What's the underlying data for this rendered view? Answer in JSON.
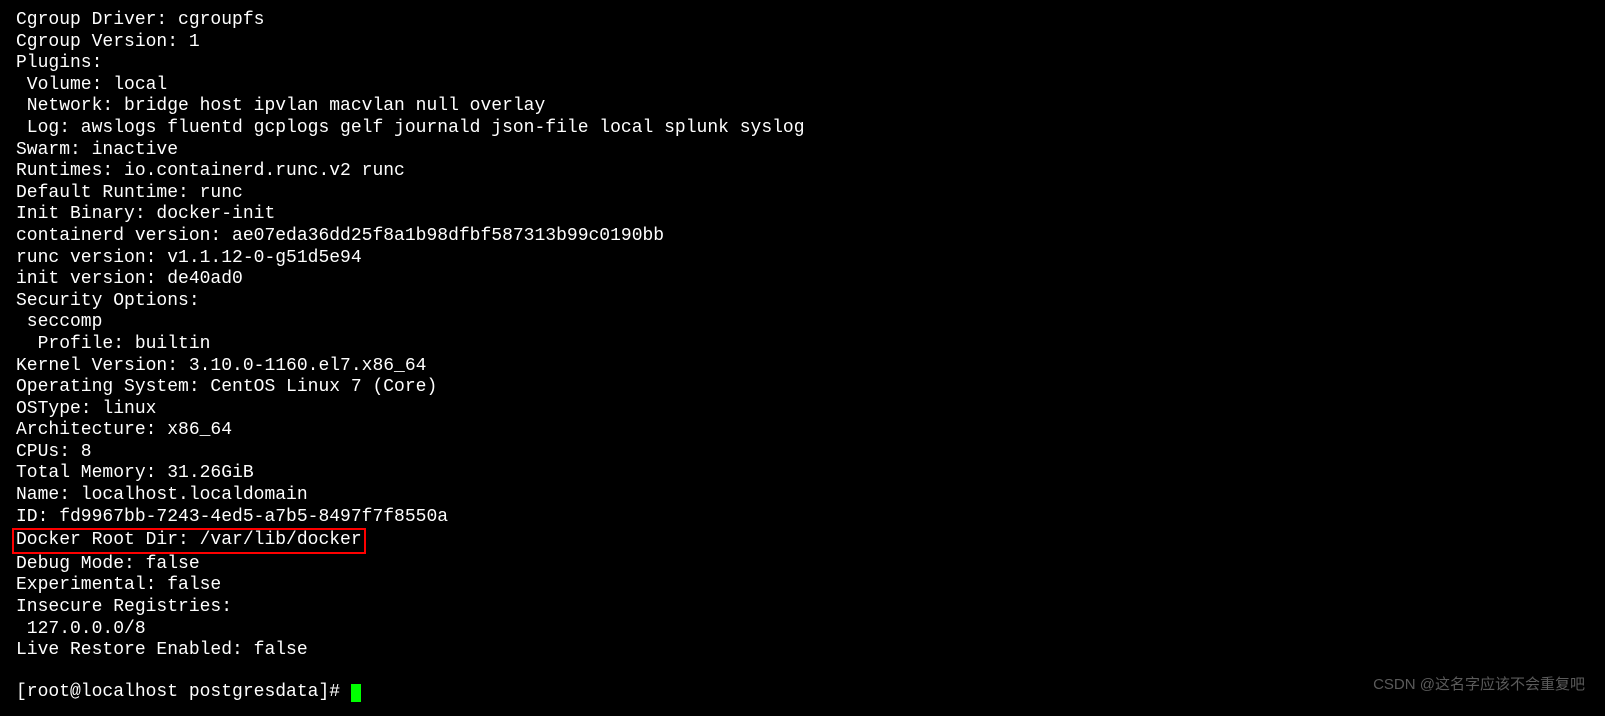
{
  "terminal": {
    "lines": {
      "cgroup_driver": "Cgroup Driver: cgroupfs",
      "cgroup_version": "Cgroup Version: 1",
      "plugins": "Plugins:",
      "volume": " Volume: local",
      "network": " Network: bridge host ipvlan macvlan null overlay",
      "log": " Log: awslogs fluentd gcplogs gelf journald json-file local splunk syslog",
      "swarm": "Swarm: inactive",
      "runtimes": "Runtimes: io.containerd.runc.v2 runc",
      "default_runtime": "Default Runtime: runc",
      "init_binary": "Init Binary: docker-init",
      "containerd_version": "containerd version: ae07eda36dd25f8a1b98dfbf587313b99c0190bb",
      "runc_version": "runc version: v1.1.12-0-g51d5e94",
      "init_version": "init version: de40ad0",
      "security_options": "Security Options:",
      "seccomp": " seccomp",
      "profile": "  Profile: builtin",
      "kernel_version": "Kernel Version: 3.10.0-1160.el7.x86_64",
      "operating_system": "Operating System: CentOS Linux 7 (Core)",
      "ostype": "OSType: linux",
      "architecture": "Architecture: x86_64",
      "cpus": "CPUs: 8",
      "total_memory": "Total Memory: 31.26GiB",
      "name": "Name: localhost.localdomain",
      "id": "ID: fd9967bb-7243-4ed5-a7b5-8497f7f8550a",
      "docker_root_dir": "Docker Root Dir: /var/lib/docker",
      "debug_mode": "Debug Mode: false",
      "experimental": "Experimental: false",
      "insecure_registries": "Insecure Registries:",
      "registry_ip": " 127.0.0.0/8",
      "live_restore": "Live Restore Enabled: false"
    },
    "prompt": "[root@localhost postgresdata]# "
  },
  "watermark": "CSDN @这名字应该不会重复吧"
}
